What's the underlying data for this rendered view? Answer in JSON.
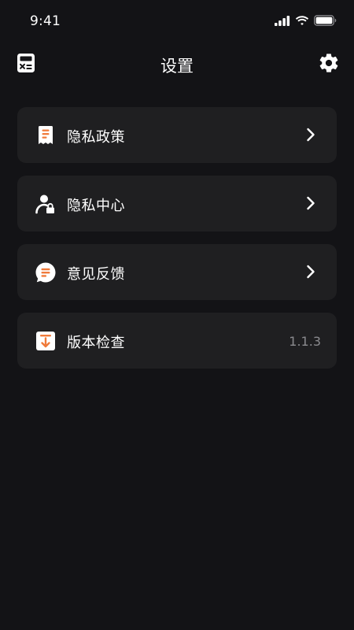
{
  "status_bar": {
    "time": "9:41"
  },
  "header": {
    "title": "设置",
    "left_icon": "calculator-icon",
    "right_icon": "gear-icon"
  },
  "menu": {
    "items": [
      {
        "label": "隐私政策",
        "icon": "receipt-document-icon",
        "trailing": "chevron-right-icon"
      },
      {
        "label": "隐私中心",
        "icon": "user-lock-icon",
        "trailing": "chevron-right-icon"
      },
      {
        "label": "意见反馈",
        "icon": "chat-bubble-icon",
        "trailing": "chevron-right-icon"
      },
      {
        "label": "版本检查",
        "icon": "download-box-icon",
        "value": "1.1.3"
      }
    ]
  },
  "colors": {
    "background": "#131316",
    "card": "#1f1f21",
    "accent": "#f07a3a",
    "text": "#ffffff",
    "secondary_text": "#8a8a8e"
  }
}
